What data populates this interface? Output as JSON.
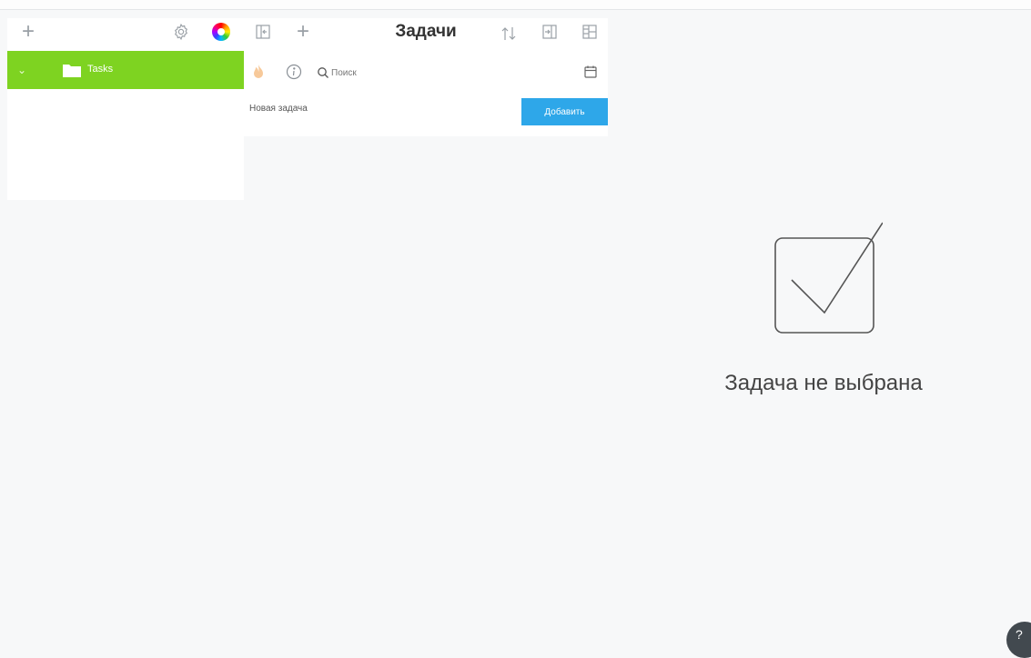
{
  "colors": {
    "accent_green": "#7ed321",
    "button_blue": "#2ea7e9",
    "icon_gray": "#9aa0a6"
  },
  "sidebar": {
    "add_icon": "plus-icon",
    "settings_icon": "gear-icon",
    "theme_icon": "color-wheel-icon",
    "folders": [
      {
        "label": "Tasks",
        "icon": "folder-icon",
        "expanded": true,
        "selected": true
      }
    ]
  },
  "task_list": {
    "title": "Задачи",
    "toolbar_icons": [
      "expand-panel-icon",
      "plus-icon",
      "sort-icon",
      "move-into-icon",
      "layout-icon"
    ],
    "filters": {
      "priority_icon": "flame-icon",
      "info_icon": "info-icon",
      "search_placeholder": "Поиск",
      "calendar_icon": "calendar-icon"
    },
    "new_task": {
      "placeholder": "Новая задача",
      "add_button": "Добавить"
    }
  },
  "detail": {
    "empty_message": "Задача не выбрана",
    "empty_icon": "checkbox-check-icon"
  },
  "help_button": {
    "label": "?"
  }
}
